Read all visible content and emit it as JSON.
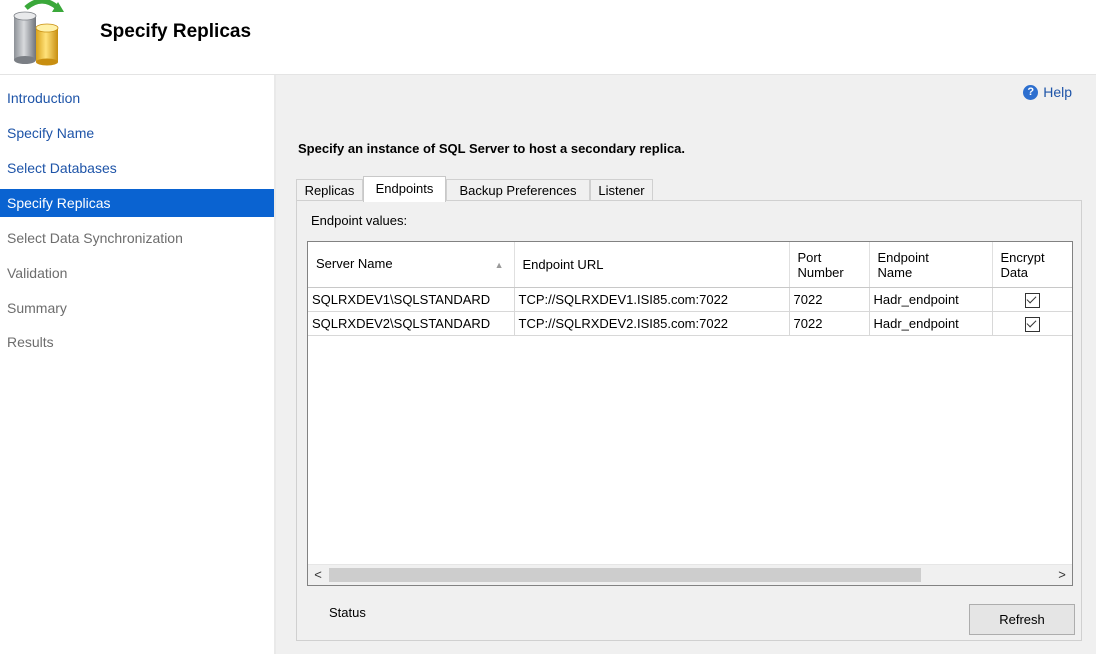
{
  "header": {
    "title": "Specify Replicas",
    "icon": "database-refresh-icon"
  },
  "sidebar": {
    "items": [
      {
        "label": "Introduction",
        "state": "link"
      },
      {
        "label": "Specify Name",
        "state": "link"
      },
      {
        "label": "Select Databases",
        "state": "link"
      },
      {
        "label": "Specify Replicas",
        "state": "selected"
      },
      {
        "label": "Select Data Synchronization",
        "state": "disabled"
      },
      {
        "label": "Validation",
        "state": "disabled"
      },
      {
        "label": "Summary",
        "state": "disabled"
      },
      {
        "label": "Results",
        "state": "disabled"
      }
    ]
  },
  "main": {
    "help_label": "Help",
    "instruction": "Specify an instance of SQL Server to host a secondary replica.",
    "tabs": [
      {
        "label": "Replicas",
        "active": false
      },
      {
        "label": "Endpoints",
        "active": true
      },
      {
        "label": "Backup Preferences",
        "active": false
      },
      {
        "label": "Listener",
        "active": false
      }
    ],
    "panel_label": "Endpoint values:",
    "table": {
      "columns": [
        "Server Name",
        "Endpoint URL",
        "Port\nNumber",
        "Endpoint\nName",
        "Encrypt\nData"
      ],
      "sort_column": "Server Name",
      "rows": [
        {
          "server": "SQLRXDEV1\\SQLSTANDARD",
          "url": "TCP://SQLRXDEV1.ISI85.com:7022",
          "port": "7022",
          "endpoint": "Hadr_endpoint",
          "encrypt": true
        },
        {
          "server": "SQLRXDEV2\\SQLSTANDARD",
          "url": "TCP://SQLRXDEV2.ISI85.com:7022",
          "port": "7022",
          "endpoint": "Hadr_endpoint",
          "encrypt": true
        }
      ]
    },
    "scroll": {
      "left": "<",
      "right": ">"
    },
    "status_label": "Status",
    "refresh_label": "Refresh"
  },
  "colors": {
    "accent": "#0a63d1",
    "link": "#1e54a8",
    "panel_bg": "#f0f0f0"
  }
}
